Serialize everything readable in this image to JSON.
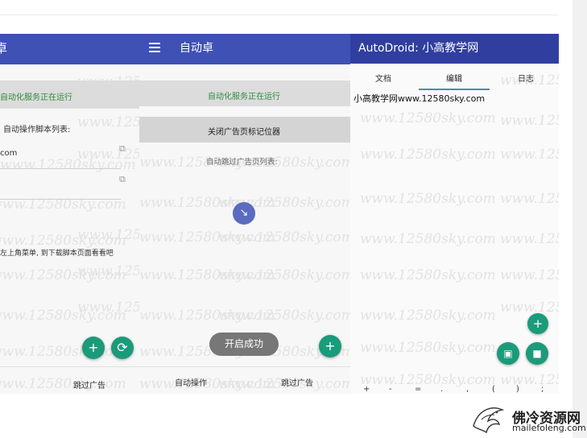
{
  "watermark": "www.12580sky.com",
  "panel1": {
    "title": "卓",
    "service_status": "自动化服务正在运行",
    "script_list_label": "自动操作脚本列表:",
    "script_item": "com",
    "hint_text": "左上角菜单, 到下载脚本页面看看吧",
    "bottom_nav_skip": "跳过广告",
    "fab_add": "+",
    "fab_refresh": "⟳"
  },
  "panel2": {
    "title": "自动卓",
    "service_status": "自动化服务正在运行",
    "close_locator_button": "关闭广告页标记位器",
    "skip_list_label": "自动跳过广告页列表:",
    "toast": "开启成功",
    "bottom_nav_auto": "自动操作",
    "bottom_nav_skip": "跳过广告",
    "fab_add": "+"
  },
  "panel3": {
    "title": "AutoDroid: 小高教学网",
    "tabs": [
      "文档",
      "编辑",
      "日志"
    ],
    "active_tab": "编辑",
    "editor_text": "小高教学网www.12580sky.com",
    "keyboard_keys": [
      "+",
      "-",
      "=",
      ".",
      ",",
      "(",
      ")",
      ";"
    ],
    "fab_add": "+",
    "fab_save": "💾",
    "fab_stop": "■"
  },
  "site_logo": {
    "cn": "佛冷资源网",
    "en": "mailefoleng.com"
  },
  "colors": {
    "app_bar": "#3f51b5",
    "app_bar_dark": "#303f9f",
    "fab": "#1a9b7a",
    "status_green": "#2e8b3d"
  }
}
